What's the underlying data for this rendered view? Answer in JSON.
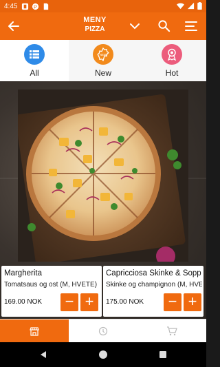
{
  "status_bar": {
    "time": "4:45"
  },
  "app_bar": {
    "title": "MENY",
    "subtitle": "PIZZA"
  },
  "categories": [
    {
      "label": "All",
      "icon": "list-icon",
      "color": "#2f8be8"
    },
    {
      "label": "New",
      "icon": "new-badge-icon",
      "color": "#f28a1c"
    },
    {
      "label": "Hot",
      "icon": "award-ribbon-icon",
      "color": "#ec5c7c"
    }
  ],
  "products": [
    {
      "name": "Margherita",
      "description": "Tomatsaus og ost (M, HVETE)",
      "price": "169.00 NOK",
      "minus": "−",
      "plus": "+"
    },
    {
      "name": "Capricciosa Skinke & Sopp",
      "description": "Skinke og champignon (M, HVETE)",
      "price": "175.00 NOK",
      "minus": "−",
      "plus": "+"
    }
  ],
  "bottom_nav": [
    "menu-icon",
    "history-icon",
    "cart-icon"
  ],
  "colors": {
    "accent": "#f06a0f",
    "status_bar": "#e8630c"
  }
}
